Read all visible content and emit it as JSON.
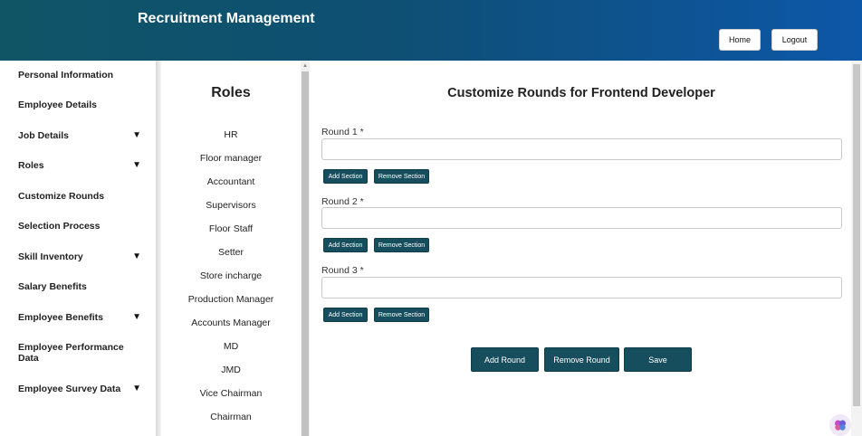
{
  "header": {
    "title": "Recruitment Management",
    "home_label": "Home",
    "logout_label": "Logout"
  },
  "sidebar": {
    "items": [
      {
        "label": "Personal Information",
        "expandable": false
      },
      {
        "label": "Employee Details",
        "expandable": false
      },
      {
        "label": "Job Details",
        "expandable": true
      },
      {
        "label": "Roles",
        "expandable": true
      },
      {
        "label": "Customize Rounds",
        "expandable": false
      },
      {
        "label": "Selection Process",
        "expandable": false
      },
      {
        "label": "Skill Inventory",
        "expandable": true
      },
      {
        "label": "Salary Benefits",
        "expandable": false
      },
      {
        "label": "Employee Benefits",
        "expandable": true
      },
      {
        "label": "Employee Performance Data",
        "expandable": false
      },
      {
        "label": "Employee Survey Data",
        "expandable": true
      }
    ],
    "arrow_glyph": "▼"
  },
  "roles": {
    "title": "Roles",
    "items": [
      "HR",
      "Floor manager",
      "Accountant",
      "Supervisors",
      "Floor Staff",
      "Setter",
      "Store incharge",
      "Production Manager",
      "Accounts Manager",
      "MD",
      "JMD",
      "Vice Chairman",
      "Chairman"
    ]
  },
  "main": {
    "title": "Customize Rounds for Frontend Developer",
    "rounds": [
      {
        "label": "Round 1 *",
        "value": ""
      },
      {
        "label": "Round 2 *",
        "value": ""
      },
      {
        "label": "Round 3 *",
        "value": ""
      }
    ],
    "add_section_label": "Add Section",
    "remove_section_label": "Remove Section",
    "add_round_label": "Add Round",
    "remove_round_label": "Remove Round",
    "save_label": "Save"
  },
  "colors": {
    "header_start": "#0f5566",
    "header_end": "#0d57a8",
    "button_bg": "#174e5e"
  },
  "icons": {
    "assistant": "assistant-icon"
  }
}
